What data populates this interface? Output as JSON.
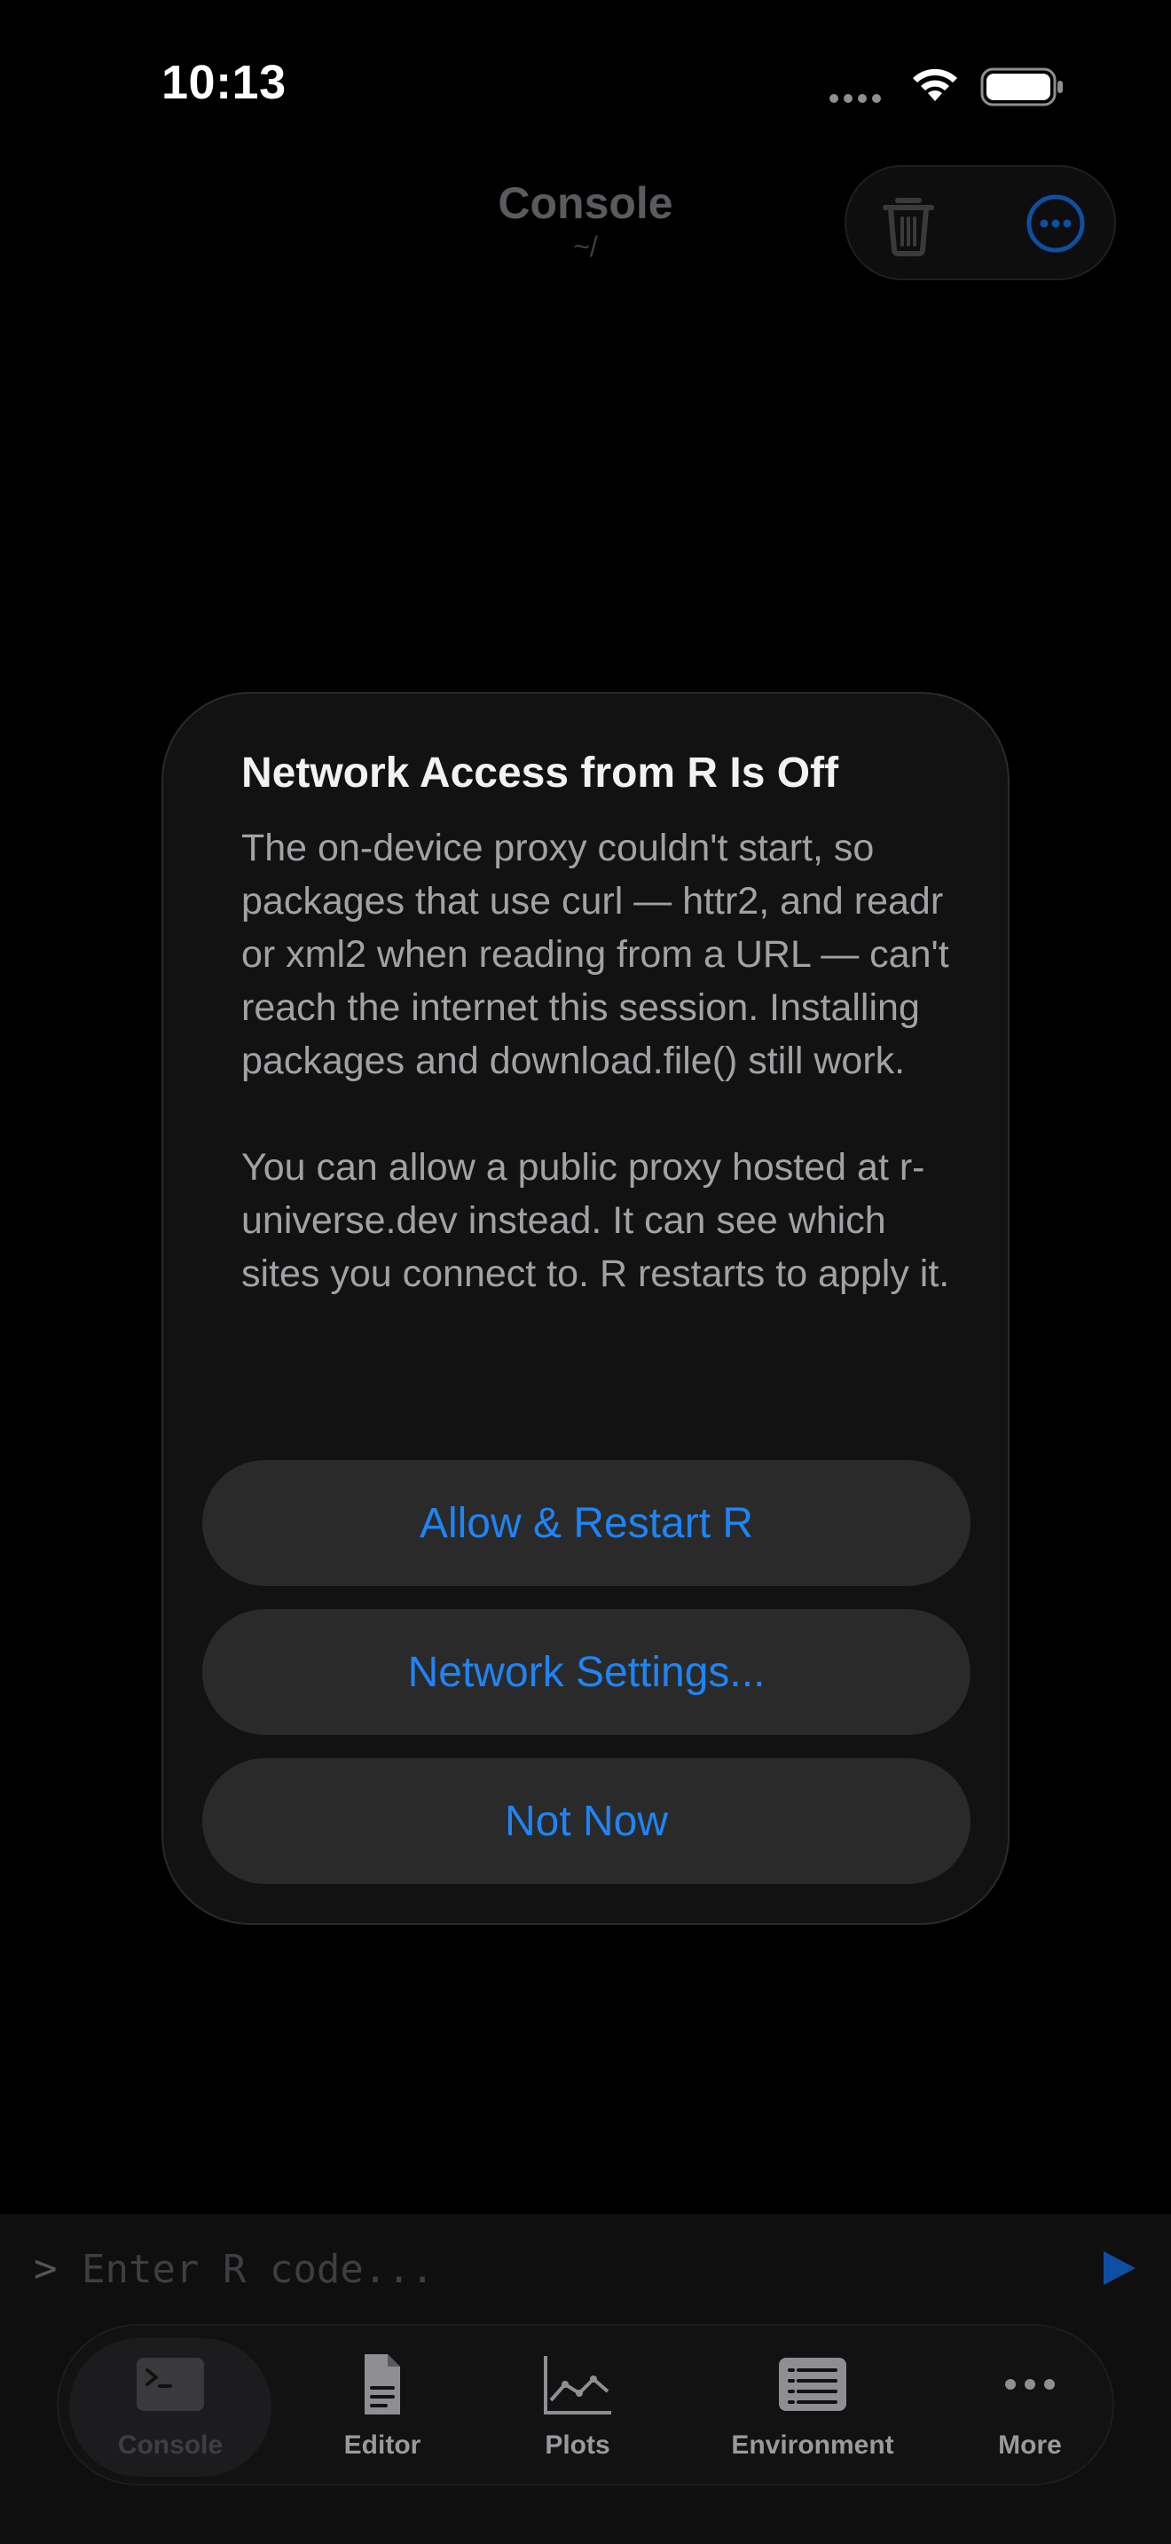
{
  "status_bar": {
    "time": "10:13"
  },
  "nav": {
    "title": "Console",
    "subtitle": "~/"
  },
  "dialog": {
    "title": "Network Access from R Is Off",
    "message_p1": "The on-device proxy couldn't start, so packages that use curl — httr2, and readr or xml2 when reading from a URL — can't reach the internet this session. Installing packages and download.file() still work.",
    "message_p2": "You can allow a public proxy hosted at r-universe.dev instead. It can see which sites you connect to. R restarts to apply it.",
    "buttons": {
      "allow": "Allow & Restart R",
      "settings": "Network Settings...",
      "not_now": "Not Now"
    }
  },
  "console_input": {
    "prompt": ">",
    "placeholder": "Enter R code...",
    "value": ""
  },
  "tabs": [
    {
      "label": "Console",
      "icon": "terminal-icon",
      "selected": true
    },
    {
      "label": "Editor",
      "icon": "document-icon",
      "selected": false
    },
    {
      "label": "Plots",
      "icon": "line-chart-icon",
      "selected": false
    },
    {
      "label": "Environment",
      "icon": "list-icon",
      "selected": false
    },
    {
      "label": "More",
      "icon": "ellipsis-icon",
      "selected": false
    }
  ],
  "colors": {
    "accent": "#1f84f5",
    "background": "#000000",
    "dialog_bg": "#121212",
    "button_bg": "#2a2a2a"
  }
}
